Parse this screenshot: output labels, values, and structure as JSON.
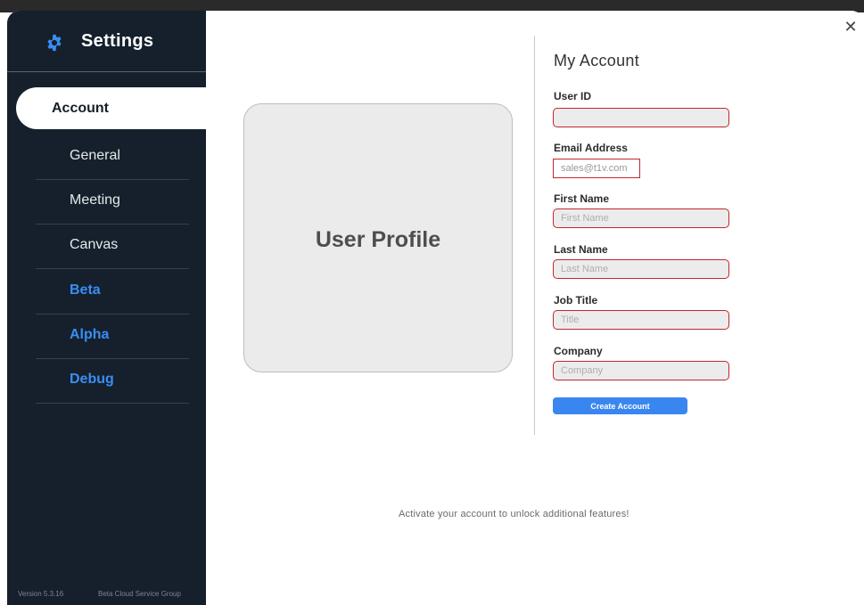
{
  "sidebar": {
    "title": "Settings",
    "items": [
      {
        "label": "Account"
      },
      {
        "label": "General"
      },
      {
        "label": "Meeting"
      },
      {
        "label": "Canvas"
      },
      {
        "label": "Beta"
      },
      {
        "label": "Alpha"
      },
      {
        "label": "Debug"
      }
    ],
    "version": "Version 5.3.16",
    "org": "Beta Cloud Service Group"
  },
  "profile": {
    "label": "User Profile"
  },
  "form": {
    "title": "My Account",
    "fields": [
      {
        "label": "User ID",
        "value": "",
        "placeholder": ""
      },
      {
        "label": "Email Address",
        "value": "sales@t1v.com",
        "placeholder": ""
      },
      {
        "label": "First Name",
        "value": "",
        "placeholder": "First Name"
      },
      {
        "label": "Last Name",
        "value": "",
        "placeholder": "Last Name"
      },
      {
        "label": "Job Title",
        "value": "",
        "placeholder": "Title"
      },
      {
        "label": "Company",
        "value": "",
        "placeholder": "Company"
      }
    ],
    "submit_label": "Create Account"
  },
  "footer_message": "Activate your account to unlock additional features!",
  "close_symbol": "✕",
  "colors": {
    "sidebar_bg": "#15202c",
    "accent": "#3a86f0",
    "error_border": "#c0272d"
  }
}
